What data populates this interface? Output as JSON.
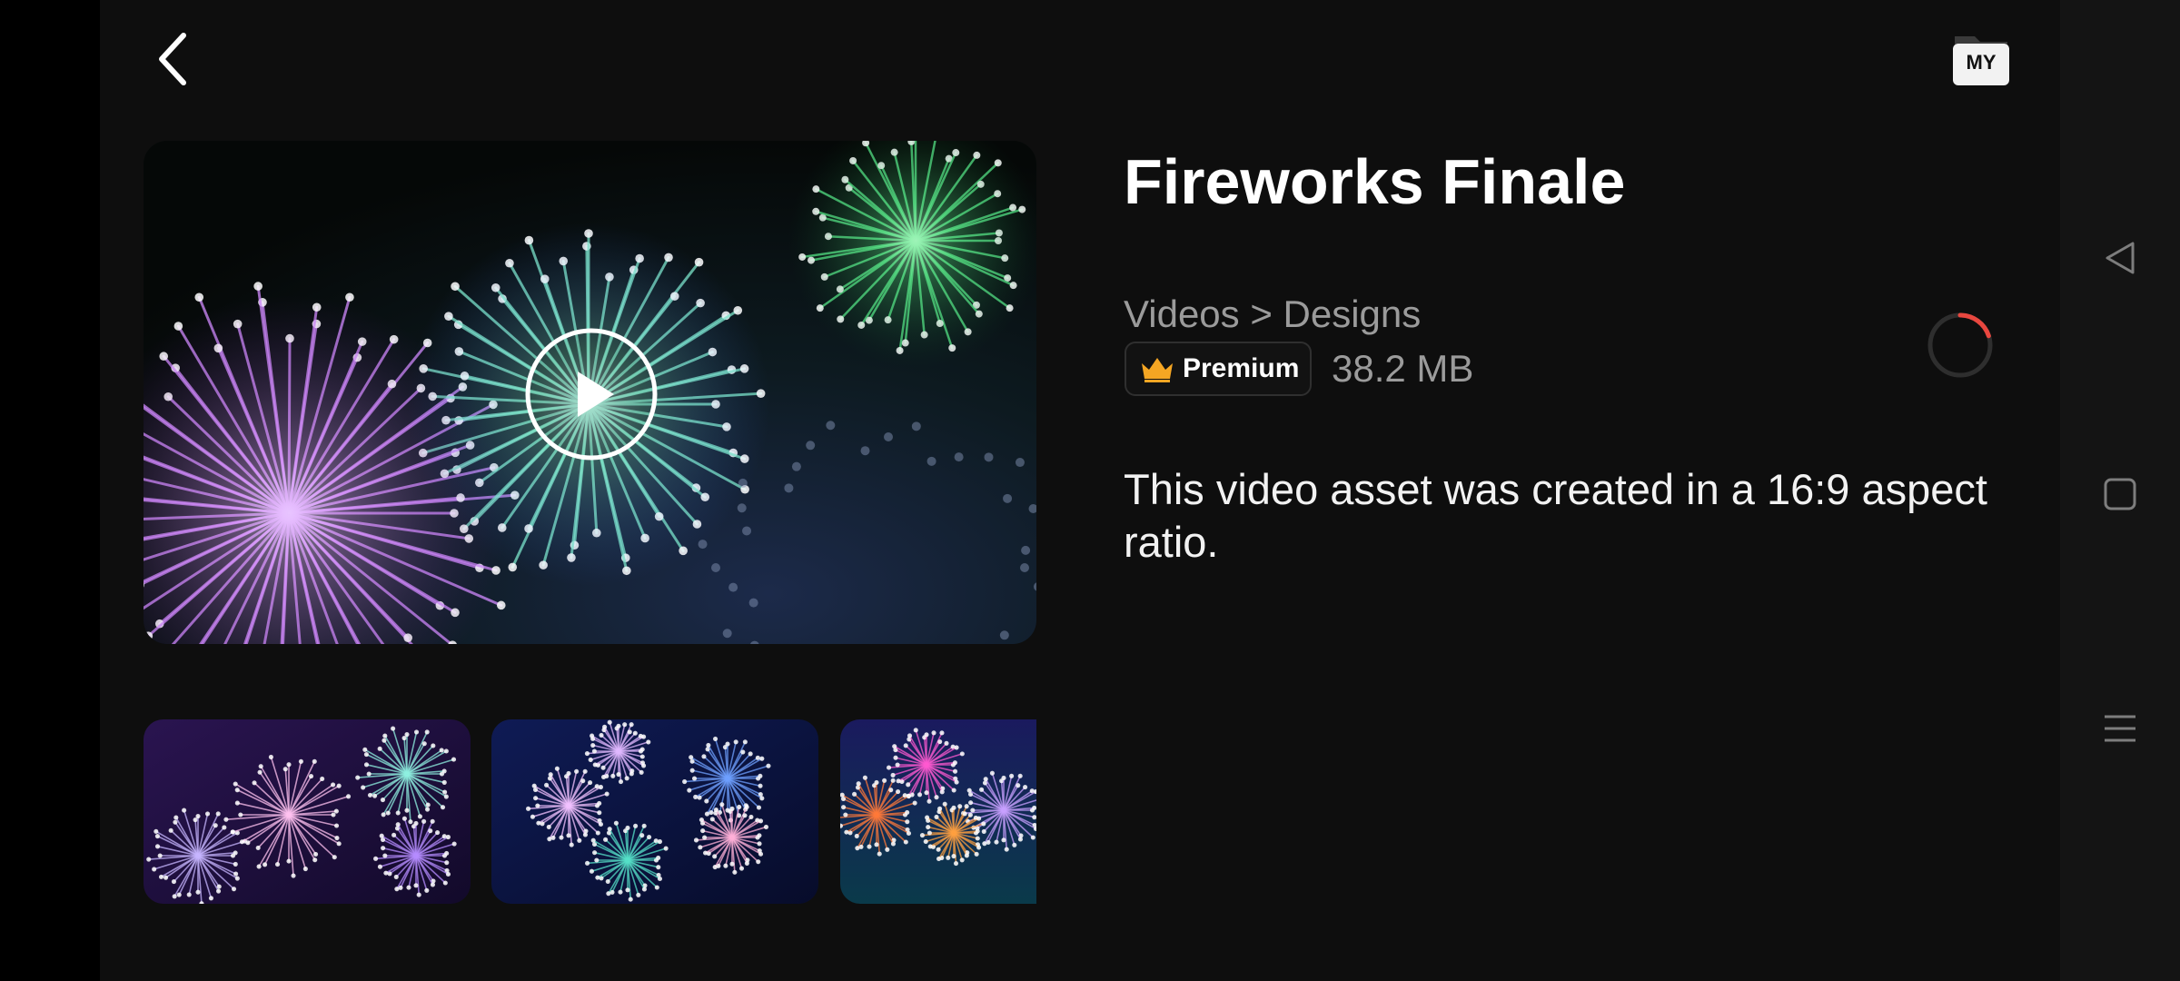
{
  "header": {
    "back_icon": "chevron-left-icon",
    "my_button_label": "MY"
  },
  "asset": {
    "title": "Fireworks Finale",
    "breadcrumb": "Videos > Designs",
    "badge_label": "Premium",
    "badge_icon": "crown-icon",
    "file_size": "38.2 MB",
    "description": "This video asset was created in a 16:9 aspect ratio.",
    "loading_indicator_progress": 0.2
  },
  "preview": {
    "play_icon": "play-icon",
    "thumbnails": [
      "thumbnail-1",
      "thumbnail-2",
      "thumbnail-3"
    ]
  },
  "system_nav": [
    "back-triangle-icon",
    "home-square-icon",
    "recents-menu-icon"
  ],
  "colors": {
    "background": "#0e0e0e",
    "secondary_text": "#9b9b9b",
    "badge_crown": "#f5a623",
    "spinner_accent": "#e8473f"
  }
}
